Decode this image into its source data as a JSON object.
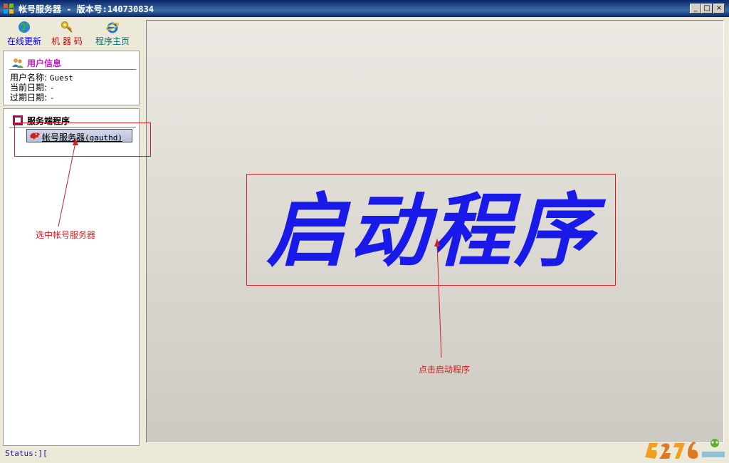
{
  "window": {
    "title": "帐号服务器 - 版本号:140730834",
    "controls": {
      "minimize": "_",
      "maximize": "□",
      "close": "×"
    }
  },
  "toolbar": {
    "items": [
      {
        "label": "在线更新",
        "icon": "globe-update-icon",
        "color": "#0000cc"
      },
      {
        "label": "机 器 码",
        "icon": "key-icon",
        "color": "#cc0000"
      },
      {
        "label": "程序主页",
        "icon": "ie-home-icon",
        "color": "#007070"
      }
    ]
  },
  "user_panel": {
    "header": "用户信息",
    "icon": "users-icon",
    "rows": [
      {
        "label": "用户名称:",
        "value": "Guest"
      },
      {
        "label": "当前日期:",
        "value": "-"
      },
      {
        "label": "过期日期:",
        "value": "-"
      }
    ]
  },
  "server_panel": {
    "header": "服务端程序",
    "icon": "server-app-icon",
    "item": {
      "label_cn": "帐号服务器",
      "label_id": "(gauthd)",
      "icon": "red-dragon-icon"
    }
  },
  "main": {
    "start_label": "启动程序"
  },
  "annotations": {
    "select_note": "选中帐号服务器",
    "start_note": "点击启动程序",
    "color": "#d02020"
  },
  "status": {
    "text": "Status:]["
  },
  "colors": {
    "title_bar": "#0a246a",
    "start_text": "#1a1ae8",
    "annotation": "#d02020"
  }
}
